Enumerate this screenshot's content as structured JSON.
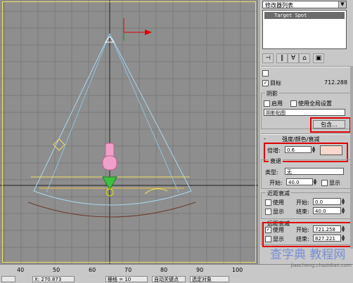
{
  "panel": {
    "dropdown_label": "修改器列表",
    "modifier_item": "Target Spot",
    "target_label": "目标",
    "target_value": "712.288",
    "shadow_header": "阴影",
    "shadow_enable": "启用",
    "use_global": "使用全局设置",
    "shadow_type": "阴影贴图",
    "include_button": "包含...",
    "rollout_title": "强度/颜色/衰减",
    "multiplier_label": "倍增:",
    "multiplier_value": "0.6",
    "decay_header": "衰退",
    "type_label": "类型:",
    "type_value": "无",
    "start_label": "开始:",
    "start_value": "40.0",
    "show_label": "显示",
    "near_header": "近距衰减",
    "near_use": "使用",
    "near_start_label": "开始:",
    "near_start_value": "0.0",
    "near_show": "显示",
    "near_end_label": "结束:",
    "near_end_value": "40.0",
    "far_header": "远距衰减",
    "far_use": "使用",
    "far_start_label": "开始:",
    "far_start_value": "721.258",
    "far_show": "显示",
    "far_end_label": "结束:",
    "far_end_value": "827.221",
    "far_use_checked": "✓",
    "target_checked": "✓"
  },
  "timeline": {
    "ticks": [
      "40",
      "50",
      "60",
      "70",
      "80",
      "90",
      "100"
    ],
    "status": [
      "X: 270.873",
      "栅格 = 10",
      "自动关键点",
      "选定对象"
    ]
  },
  "watermark": {
    "text": "查字典 教程网",
    "url": "jiaocheng.chazidian.com"
  },
  "colors": {
    "viewport_bg": "#8e8e8e",
    "highlight": "#e00000",
    "color_swatch": "#f8d8cc"
  }
}
